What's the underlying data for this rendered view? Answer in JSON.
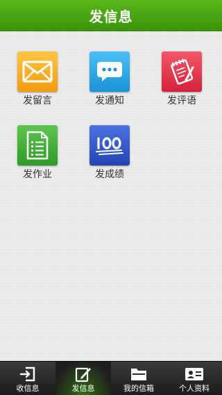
{
  "header": {
    "title": "发信息"
  },
  "tiles": [
    {
      "label": "发留言",
      "icon": "envelope-icon",
      "color": "#f5a623"
    },
    {
      "label": "发通知",
      "icon": "chat-bubble-icon",
      "color": "#29a9e8"
    },
    {
      "label": "发评语",
      "icon": "notepad-pen-icon",
      "color": "#e8364a"
    },
    {
      "label": "发作业",
      "icon": "document-list-icon",
      "color": "#3fae35"
    },
    {
      "label": "发成绩",
      "icon": "score-100-icon",
      "color": "#2f55c8"
    }
  ],
  "tabbar": {
    "items": [
      {
        "label": "收信息",
        "icon": "inbox-arrow-icon",
        "active": false
      },
      {
        "label": "发信息",
        "icon": "edit-pen-icon",
        "active": true
      },
      {
        "label": "我的信箱",
        "icon": "folder-icon",
        "active": false
      },
      {
        "label": "个人资料",
        "icon": "id-card-icon",
        "active": false
      }
    ]
  },
  "colors": {
    "header_green": "#4aa814",
    "tabbar_dark": "#2a2a2a",
    "background": "#e9e9e9"
  }
}
